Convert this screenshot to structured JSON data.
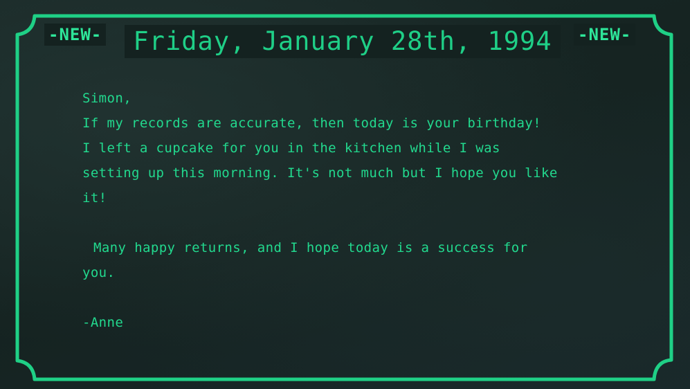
{
  "note": {
    "badge_left": "-NEW-",
    "badge_right": "-NEW-",
    "date_title": "Friday, January 28th, 1994",
    "greeting": "Simon,",
    "body_lines": [
      "If my records are accurate, then today is your birthday!",
      "I left a cupcake for you in the kitchen while I was",
      "setting up this morning. It's not much but I hope you like",
      "it!"
    ],
    "closing_lines": [
      "Many happy returns, and I hope today is a success for",
      "you."
    ],
    "signature": "-Anne"
  },
  "colors": {
    "accent": "#22d98e",
    "border": "#1fd086",
    "background": "#142220"
  }
}
